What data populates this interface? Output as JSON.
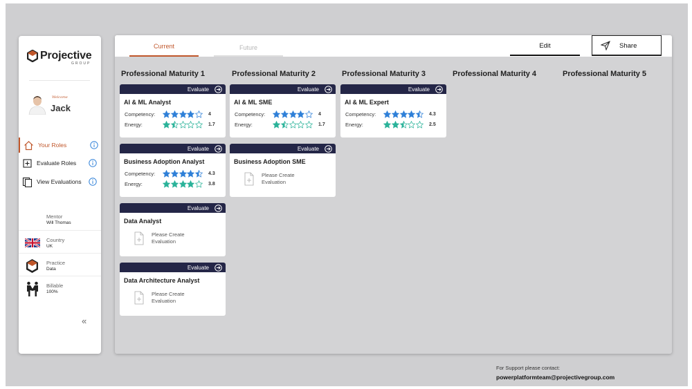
{
  "brand": {
    "name": "Projective",
    "sub": "GROUP"
  },
  "user": {
    "welcome": "Welcome",
    "name": "Jack"
  },
  "nav": [
    {
      "label": "Your Roles",
      "icon": "home-icon",
      "active": true
    },
    {
      "label": "Evaluate Roles",
      "icon": "add-box-icon",
      "active": false
    },
    {
      "label": "View Evaluations",
      "icon": "copy-icon",
      "active": false
    }
  ],
  "profile": {
    "mentor": {
      "label": "Mentor",
      "value": "Will Thomas"
    },
    "country": {
      "label": "Country",
      "value": "UK"
    },
    "practice": {
      "label": "Practice",
      "value": "Data"
    },
    "billable": {
      "label": "Billable",
      "value": "100%"
    }
  },
  "collapse_glyph": "«",
  "tabs": {
    "current": "Current",
    "future": "Future"
  },
  "actions": {
    "edit": "Edit",
    "share": "Share"
  },
  "columns": [
    "Professional Maturity 1",
    "Professional Maturity 2",
    "Professional Maturity 3",
    "Professional Maturity 4",
    "Professional Maturity 5"
  ],
  "evaluate_label": "Evaluate",
  "competency_label": "Competency:",
  "energy_label": "Energy:",
  "empty_text": "Please Create Evaluation",
  "colors": {
    "accent": "#c0562a",
    "card_header": "#242647",
    "competency_star": "#2f80d8",
    "energy_star": "#2bb39a"
  },
  "cards": {
    "c1a": {
      "title": "AI & ML Analyst",
      "competency": "4",
      "energy": "1.7"
    },
    "c1b": {
      "title": "Business Adoption Analyst",
      "competency": "4.3",
      "energy": "3.8"
    },
    "c1c": {
      "title": "Data Analyst"
    },
    "c1d": {
      "title": "Data Architecture Analyst"
    },
    "c2a": {
      "title": "AI & ML SME",
      "competency": "4",
      "energy": "1.7"
    },
    "c2b": {
      "title": "Business Adoption SME"
    },
    "c3a": {
      "title": "AI & ML Expert",
      "competency": "4.3",
      "energy": "2.5"
    }
  },
  "support": {
    "label": "For Support please contact:",
    "email": "powerplatformteam@projectivegroup.com"
  }
}
